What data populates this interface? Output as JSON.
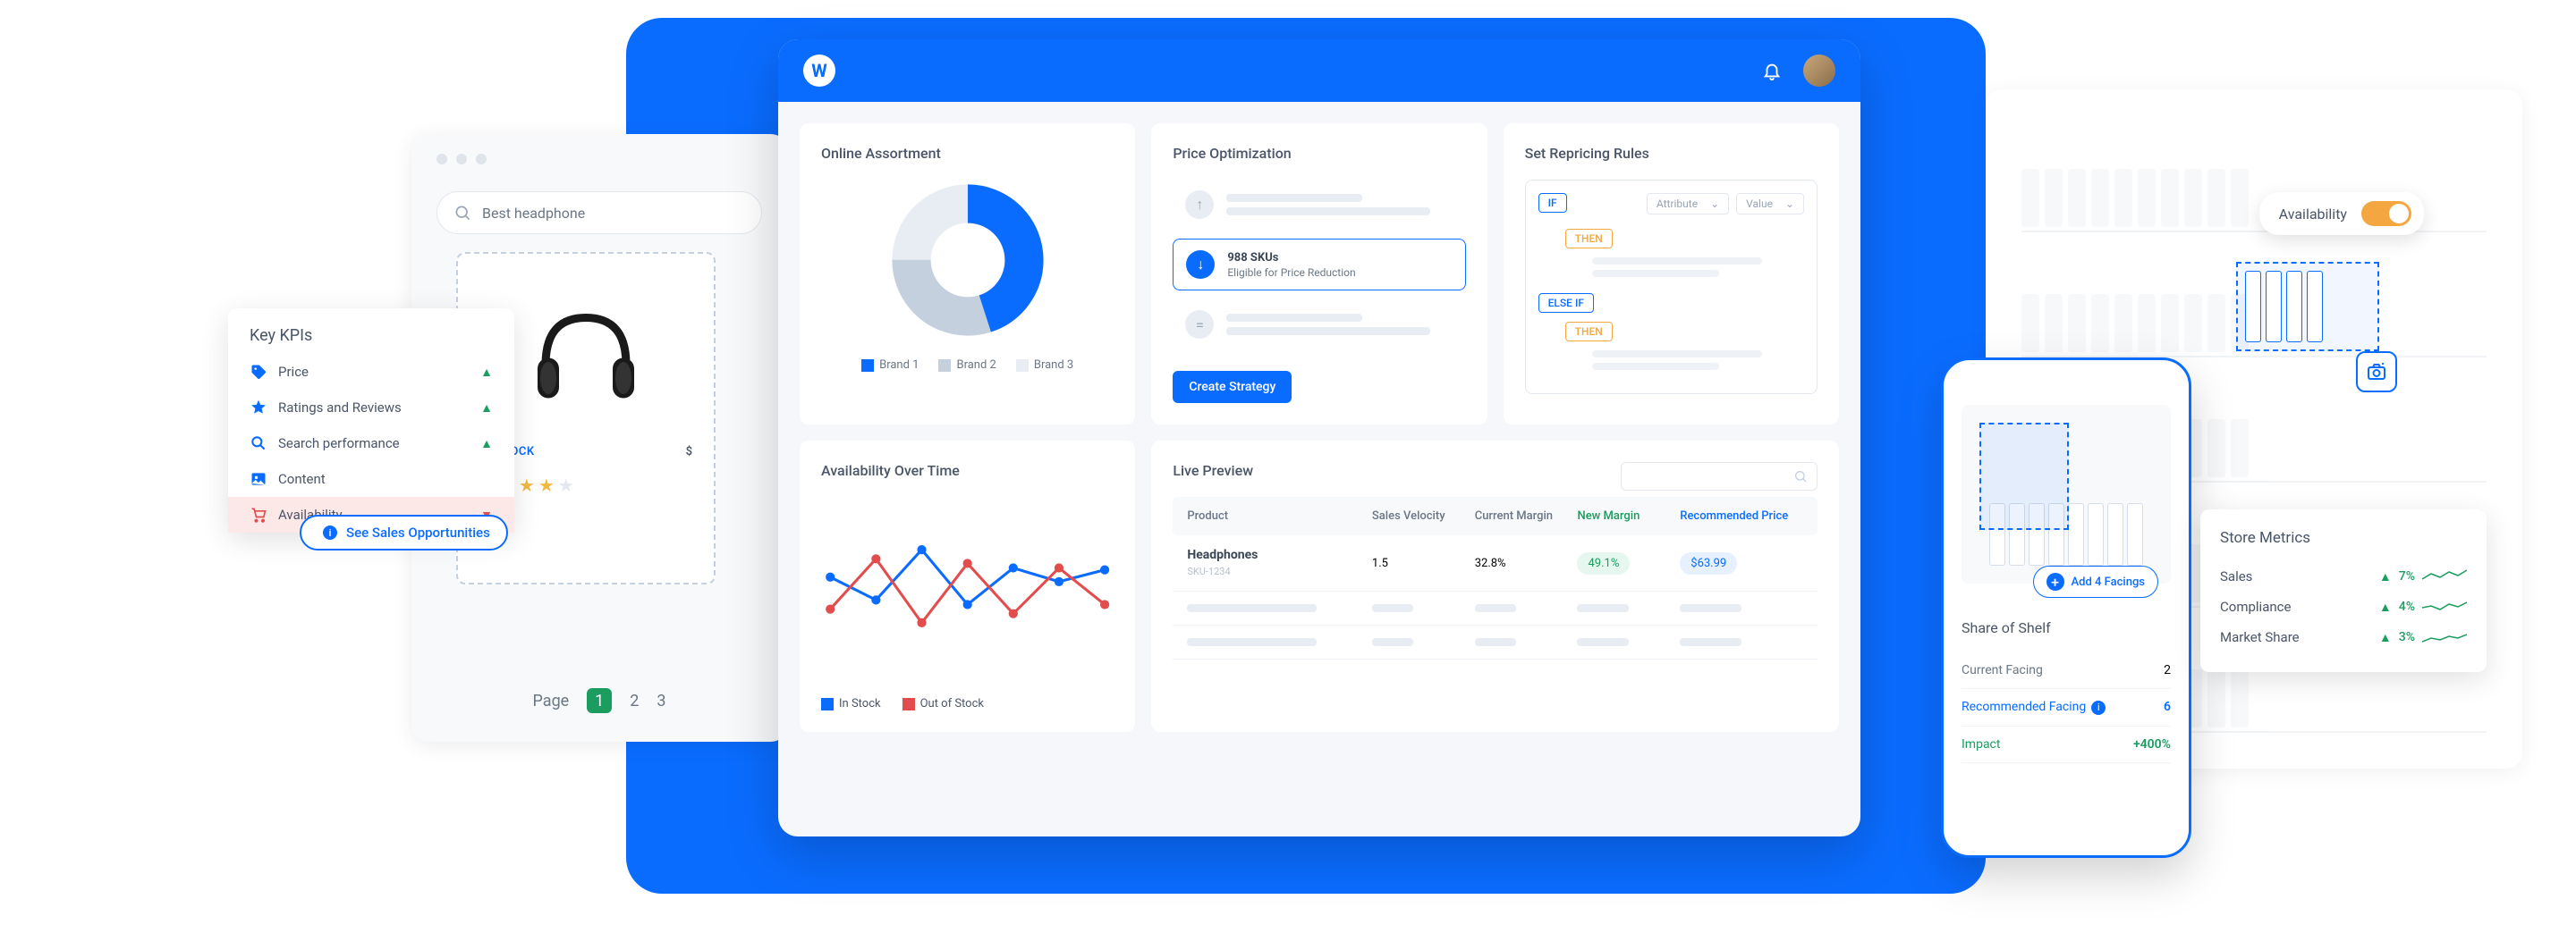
{
  "browser_left": {
    "search_placeholder": "Best headphone",
    "product": {
      "stock_label": "IN STOCK",
      "price_prefix": "$"
    },
    "pagination": {
      "label": "Page",
      "pages": [
        "1",
        "2",
        "3"
      ],
      "current": "1"
    }
  },
  "kpi": {
    "title": "Key KPIs",
    "rows": [
      {
        "icon": "price-icon",
        "label": "Price",
        "trend": "up"
      },
      {
        "icon": "star-icon",
        "label": "Ratings and Reviews",
        "trend": "up"
      },
      {
        "icon": "search-icon",
        "label": "Search performance",
        "trend": "up"
      },
      {
        "icon": "image-icon",
        "label": "Content",
        "trend": "none"
      },
      {
        "icon": "cart-icon",
        "label": "Availability",
        "trend": "down"
      }
    ],
    "sales_opp": "See Sales Opportunities"
  },
  "main": {
    "assortment": {
      "title": "Online Assortment",
      "legend": [
        "Brand 1",
        "Brand 2",
        "Brand 3"
      ],
      "colors": [
        "#0a6cff",
        "#c5d0de",
        "#e8edf3"
      ]
    },
    "price_opt": {
      "title": "Price Optimization",
      "highlighted": {
        "count": "988 SKUs",
        "sub": "Eligible for Price Reduction"
      },
      "cta": "Create Strategy"
    },
    "rules": {
      "title": "Set Repricing Rules",
      "tags": {
        "if": "IF",
        "then": "THEN",
        "elseif": "ELSE IF"
      },
      "selects": [
        "Attribute",
        "Value"
      ]
    },
    "availability": {
      "title": "Availability Over Time",
      "legend": [
        "In Stock",
        "Out of Stock"
      ],
      "colors": [
        "#0a6cff",
        "#e24c4c"
      ]
    },
    "live_preview": {
      "title": "Live Preview",
      "headers": {
        "product": "Product",
        "velocity": "Sales Velocity",
        "margin": "Current Margin",
        "new_margin": "New Margin",
        "rec_price": "Recommended Price"
      },
      "row": {
        "name": "Headphones",
        "sku": "SKU-1234",
        "velocity": "1.5",
        "margin": "32.8%",
        "new_margin": "49.1%",
        "rec_price": "$63.99"
      }
    }
  },
  "phone": {
    "add_facing": "Add 4 Facings",
    "title": "Share of Shelf",
    "rows": {
      "current": {
        "label": "Current Facing",
        "value": "2"
      },
      "recommended": {
        "label": "Recommended Facing",
        "value": "6"
      },
      "impact": {
        "label": "Impact",
        "value": "+400%"
      }
    }
  },
  "avail_toggle": "Availability",
  "metrics": {
    "title": "Store Metrics",
    "rows": [
      {
        "label": "Sales",
        "value": "7%"
      },
      {
        "label": "Compliance",
        "value": "4%"
      },
      {
        "label": "Market Share",
        "value": "3%"
      }
    ]
  },
  "chart_data": [
    {
      "type": "pie",
      "title": "Online Assortment",
      "series": [
        {
          "name": "Brand 1",
          "value": 45
        },
        {
          "name": "Brand 2",
          "value": 30
        },
        {
          "name": "Brand 3",
          "value": 25
        }
      ]
    },
    {
      "type": "line",
      "title": "Availability Over Time",
      "x": [
        1,
        2,
        3,
        4,
        5,
        6,
        7
      ],
      "series": [
        {
          "name": "In Stock",
          "values": [
            55,
            42,
            68,
            40,
            60,
            52,
            58
          ]
        },
        {
          "name": "Out of Stock",
          "values": [
            38,
            60,
            30,
            58,
            35,
            55,
            40
          ]
        }
      ],
      "ylim": [
        0,
        80
      ]
    }
  ]
}
